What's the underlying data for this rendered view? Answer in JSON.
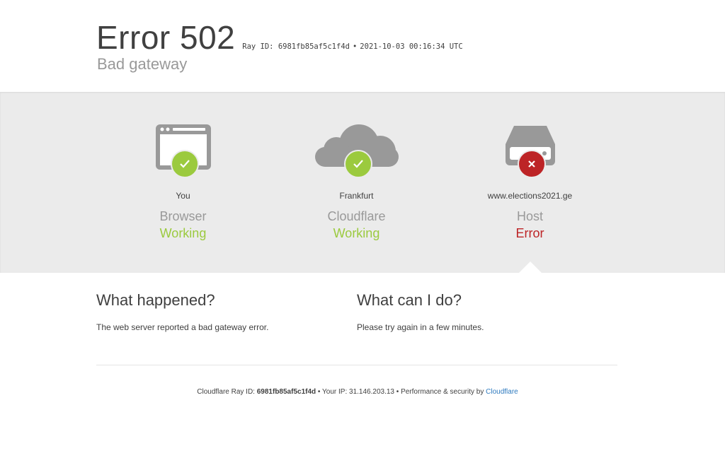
{
  "header": {
    "title": "Error 502",
    "ray_label": "Ray ID: 6981fb85af5c1f4d",
    "bullet": "•",
    "timestamp": "2021-10-03 00:16:34 UTC",
    "subtitle": "Bad gateway"
  },
  "status": [
    {
      "location": "You",
      "service": "Browser",
      "state": "Working",
      "icon": "browser-icon",
      "badge": "check"
    },
    {
      "location": "Frankfurt",
      "service": "Cloudflare",
      "state": "Working",
      "icon": "cloud-icon",
      "badge": "check"
    },
    {
      "location": "www.elections2021.ge",
      "service": "Host",
      "state": "Error",
      "icon": "server-icon",
      "badge": "cross"
    }
  ],
  "what_happened": {
    "heading": "What happened?",
    "body": "The web server reported a bad gateway error."
  },
  "what_can_i_do": {
    "heading": "What can I do?",
    "body": "Please try again in a few minutes."
  },
  "footer": {
    "ray_prefix": "Cloudflare Ray ID:",
    "ray_id": "6981fb85af5c1f4d",
    "sep1": "•",
    "ip_text": "Your IP: 31.146.203.13",
    "sep2": "•",
    "perf_text": "Performance & security by",
    "link_text": "Cloudflare"
  },
  "colors": {
    "working": "#9bca3e",
    "error": "#bd2426",
    "icon_gray": "#999999",
    "link": "#2f7bbf"
  }
}
